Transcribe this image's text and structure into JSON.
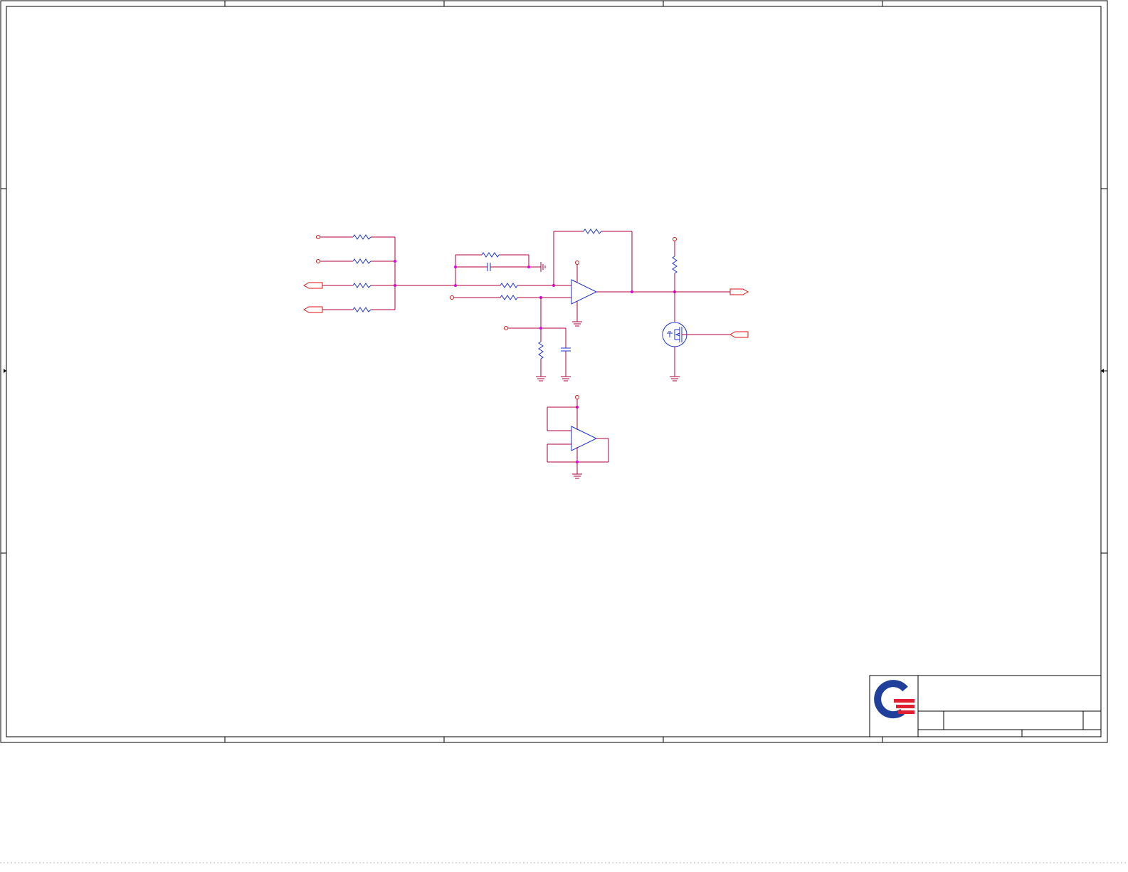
{
  "sheet": {
    "title_block": {
      "title": "",
      "size_label": "",
      "document_number": "",
      "revision": "",
      "date": "",
      "sheet_of": ""
    },
    "colors": {
      "wire": "#b0003a",
      "pin": "#e01010",
      "component_body": "#1a2fd0",
      "junction": "#e000e0",
      "frame": "#000000",
      "logo_blue": "#1f3f9a",
      "logo_red": "#e02030"
    },
    "components": {
      "input_resistors": [
        "resistor-icon",
        "resistor-icon",
        "resistor-icon",
        "resistor-icon"
      ],
      "input_ports": [
        "input-port-icon",
        "input-port-icon"
      ],
      "output_ports": [
        "output-port-icon",
        "input-port-icon"
      ],
      "op_amps": [
        "op-amp-icon",
        "op-amp-icon"
      ],
      "mosfet": "n-mosfet-icon",
      "capacitors": [
        "capacitor-icon",
        "capacitor-icon"
      ],
      "grounds": [
        "ground-icon",
        "ground-icon",
        "ground-icon",
        "ground-icon",
        "ground-icon",
        "ground-icon"
      ],
      "logo": "company-logo"
    }
  }
}
